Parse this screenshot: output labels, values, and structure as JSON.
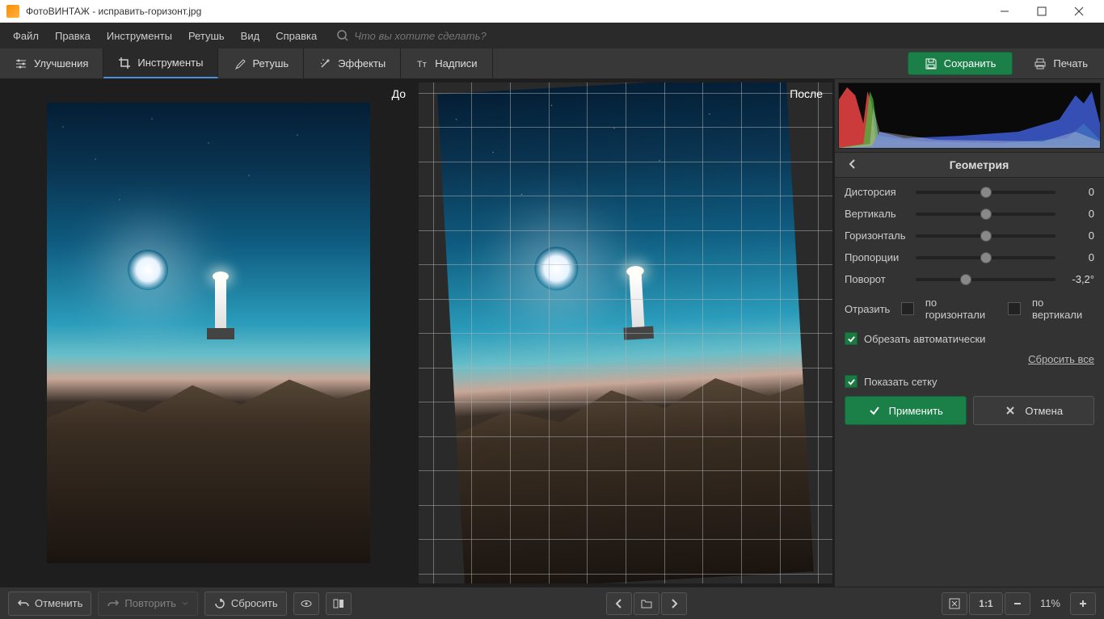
{
  "titlebar": {
    "title": "ФотоВИНТАЖ - исправить-горизонт.jpg"
  },
  "menu": {
    "items": [
      "Файл",
      "Правка",
      "Инструменты",
      "Ретушь",
      "Вид",
      "Справка"
    ],
    "search_placeholder": "Что вы хотите сделать?"
  },
  "tabs": {
    "items": [
      {
        "label": "Улучшения",
        "icon": "sliders"
      },
      {
        "label": "Инструменты",
        "icon": "crop",
        "active": true
      },
      {
        "label": "Ретушь",
        "icon": "brush"
      },
      {
        "label": "Эффекты",
        "icon": "magic"
      },
      {
        "label": "Надписи",
        "icon": "text"
      }
    ],
    "save": "Сохранить",
    "print": "Печать"
  },
  "viewport": {
    "before": "До",
    "after": "После"
  },
  "panel": {
    "title": "Геометрия",
    "sliders": [
      {
        "label": "Дисторсия",
        "value": "0",
        "pos": 50
      },
      {
        "label": "Вертикаль",
        "value": "0",
        "pos": 50
      },
      {
        "label": "Горизонталь",
        "value": "0",
        "pos": 50
      },
      {
        "label": "Пропорции",
        "value": "0",
        "pos": 50
      },
      {
        "label": "Поворот",
        "value": "-3,2°",
        "pos": 36
      }
    ],
    "flip": {
      "label": "Отразить",
      "h": "по горизонтали",
      "v": "по вертикали"
    },
    "auto_crop": "Обрезать автоматически",
    "show_grid": "Показать сетку",
    "reset": "Сбросить все",
    "apply": "Применить",
    "cancel": "Отмена"
  },
  "bottom": {
    "undo": "Отменить",
    "redo": "Повторить",
    "reset": "Сбросить",
    "oneToOne": "1:1",
    "zoom": "11%"
  }
}
